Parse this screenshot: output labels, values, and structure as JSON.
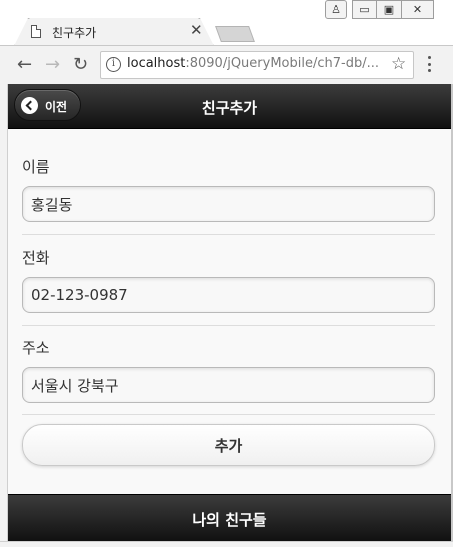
{
  "browser": {
    "tab_title": "친구추가",
    "tab_close": "✕",
    "window_buttons": {
      "user": "♙",
      "minimize": "▭",
      "maximize": "▣",
      "close": "✕"
    },
    "nav": {
      "back": "←",
      "forward": "→",
      "reload": "↻"
    },
    "info_icon": "i",
    "url_host": "localhost",
    "url_path": ":8090/jQueryMobile/ch7-db/...",
    "star": "☆"
  },
  "page": {
    "header_title": "친구추가",
    "back_button_label": "이전",
    "fields": [
      {
        "label": "이름",
        "value": "홍길동"
      },
      {
        "label": "전화",
        "value": "02-123-0987"
      },
      {
        "label": "주소",
        "value": "서울시 강북구"
      }
    ],
    "add_button_label": "추가",
    "footer_title": "나의 친구들"
  },
  "colors": {
    "header_bg": "#1f1f1f",
    "page_bg": "#f9f9f9",
    "input_border": "#b9b9b9"
  }
}
